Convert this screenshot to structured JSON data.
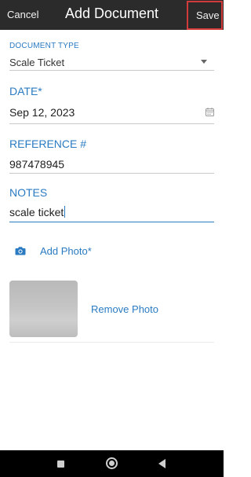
{
  "header": {
    "cancel_label": "Cancel",
    "title": "Add Document",
    "save_label": "Save"
  },
  "form": {
    "document_type": {
      "label": "DOCUMENT TYPE",
      "value": "Scale Ticket"
    },
    "date": {
      "label": "DATE*",
      "value": "Sep 12, 2023"
    },
    "reference": {
      "label": "REFERENCE #",
      "value": "987478945"
    },
    "notes": {
      "label": "NOTES",
      "value": "scale ticket"
    }
  },
  "photo": {
    "add_label": "Add Photo*",
    "remove_label": "Remove Photo"
  },
  "colors": {
    "accent": "#2a7bc2",
    "header_bg": "#2b2b2b",
    "highlight_border": "#d13b3b"
  },
  "icons": {
    "calendar": "calendar-icon",
    "camera": "camera-icon",
    "dropdown": "chevron-down-icon"
  }
}
